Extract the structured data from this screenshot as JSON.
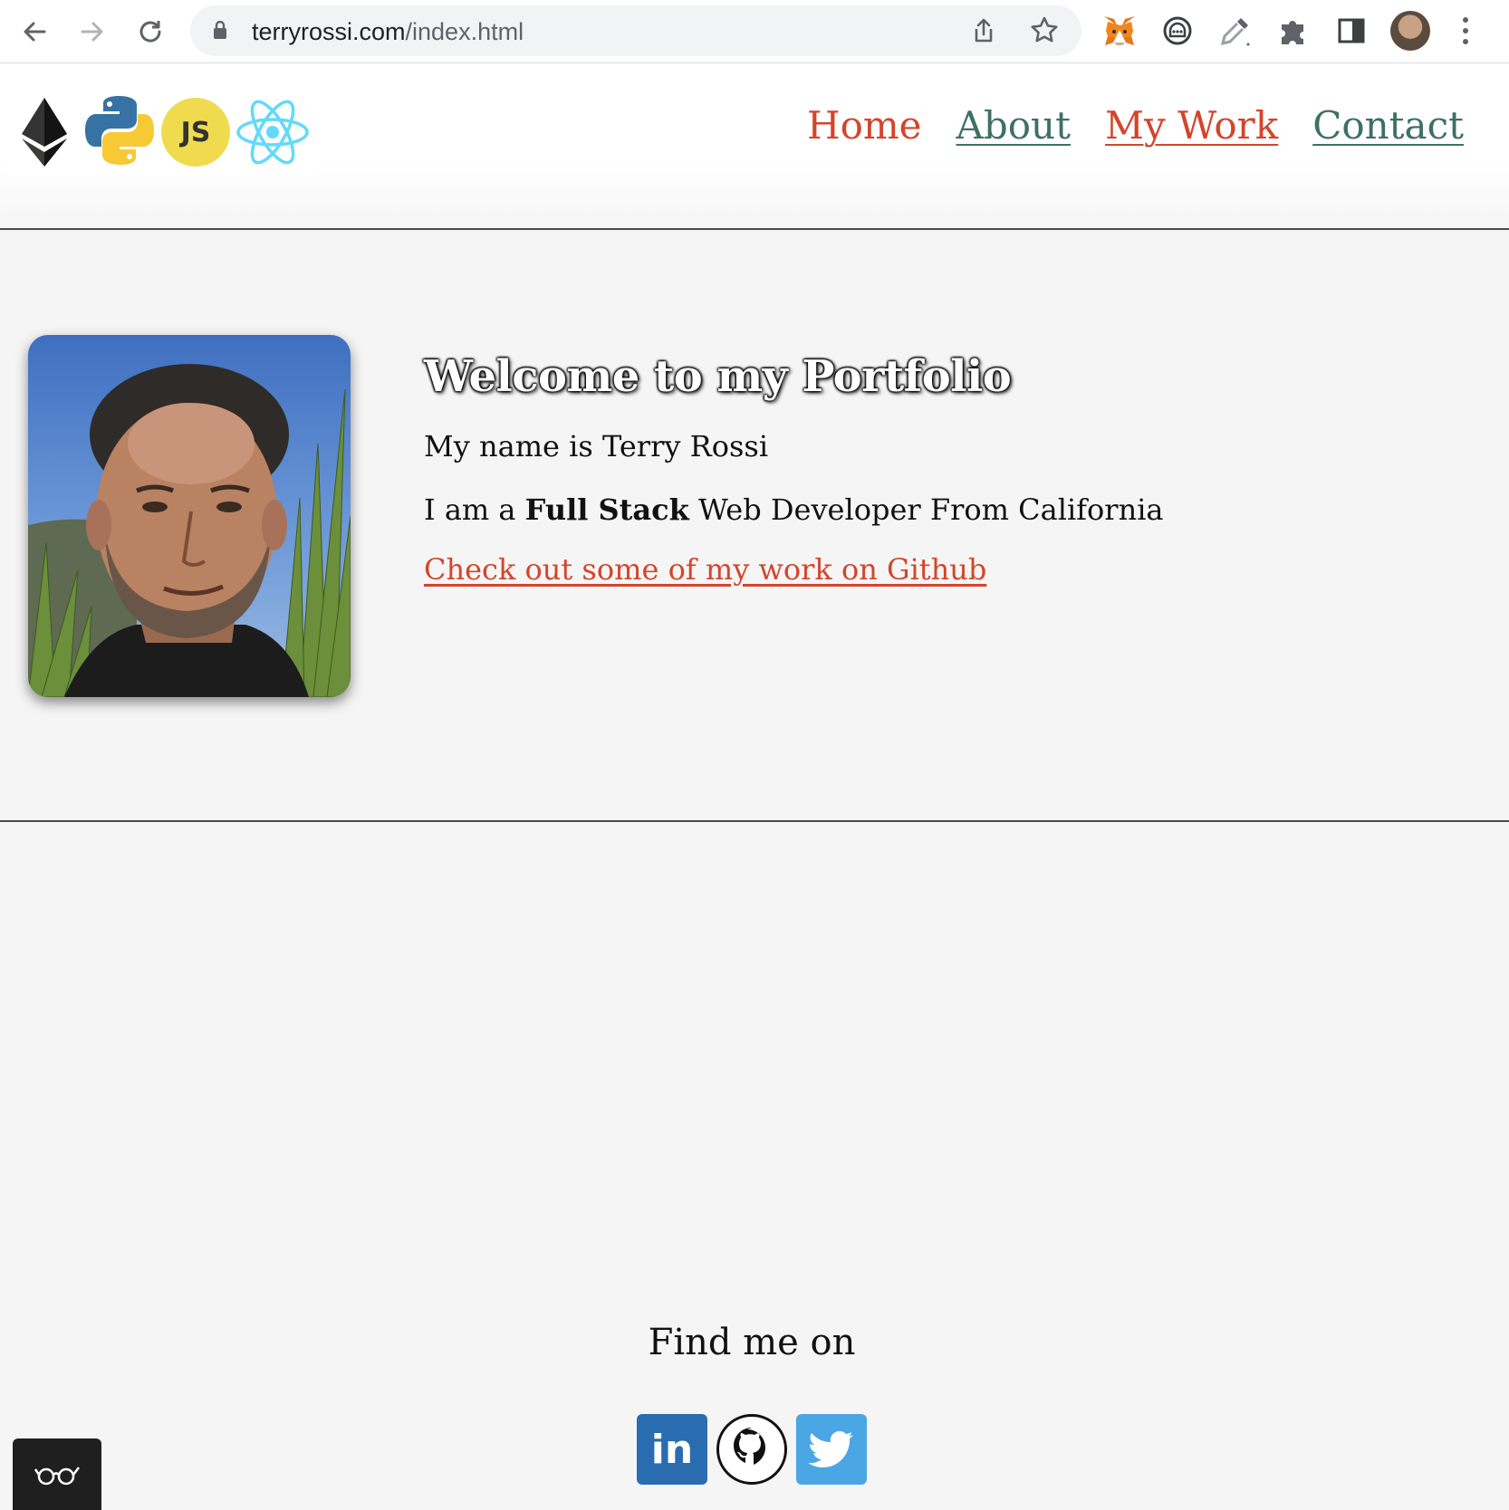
{
  "browser": {
    "url_domain": "terryrossi.com",
    "url_path": "/index.html",
    "icons": [
      "back-icon",
      "forward-icon",
      "reload-icon",
      "lock-icon",
      "share-icon",
      "star-icon",
      "metamask-icon",
      "chat-extension-icon",
      "eyedropper-icon",
      "extensions-icon",
      "side-panel-icon",
      "profile-avatar",
      "menu-icon"
    ]
  },
  "header": {
    "logos": [
      "ethereum-logo",
      "python-logo",
      "javascript-logo",
      "react-logo"
    ],
    "js_label": "JS",
    "nav": [
      {
        "label": "Home"
      },
      {
        "label": "About"
      },
      {
        "label": "My Work"
      },
      {
        "label": "Contact"
      }
    ]
  },
  "hero": {
    "title": "Welcome to my Portfolio",
    "name_line": "My name is Terry Rossi",
    "role_prefix": "I am a ",
    "role_bold": "Full Stack",
    "role_suffix": " Web Developer From California",
    "github_link": "Check out some of my work on Github"
  },
  "footer": {
    "find_me": "Find me on",
    "socials": [
      "linkedin-icon",
      "github-icon",
      "twitter-icon"
    ],
    "linkedin_label": "in"
  },
  "colors": {
    "accent_red": "#d3452b",
    "accent_teal": "#3e7064",
    "background": "#f5f5f5"
  }
}
